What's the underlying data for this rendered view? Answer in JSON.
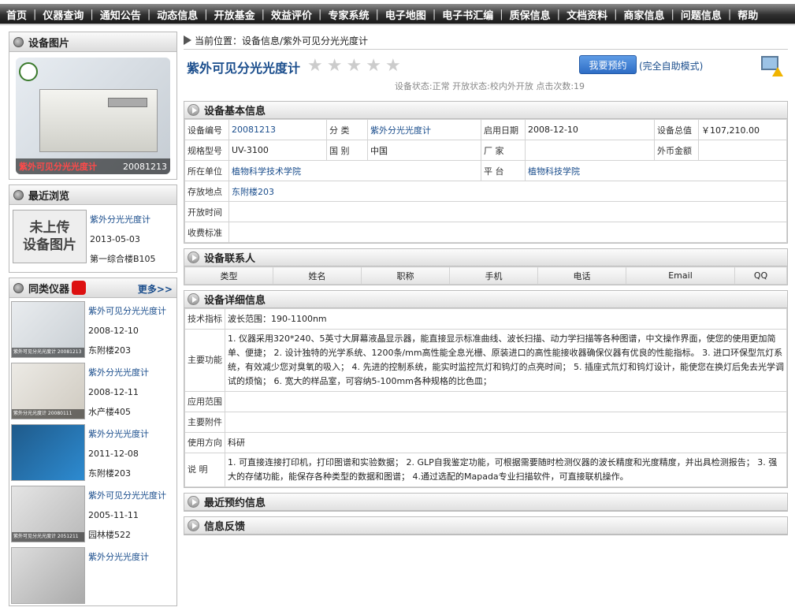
{
  "nav": [
    "首页",
    "仪器查询",
    "通知公告",
    "动态信息",
    "开放基金",
    "效益评价",
    "专家系统",
    "电子地图",
    "电子书汇编",
    "质保信息",
    "文档资料",
    "商家信息",
    "问题信息",
    "帮助"
  ],
  "sidebar": {
    "photo_title": "设备图片",
    "photo_caption_name": "紫外可见分光光度计",
    "photo_caption_id": "20081213",
    "recent_title": "最近浏览",
    "recent_nopic_1": "未上传",
    "recent_nopic_2": "设备图片",
    "recent": {
      "name": "紫外分光光度计",
      "date": "2013-05-03",
      "place": "第一综合楼B105"
    },
    "similar_title": "同类仪器",
    "more_label": "更多>>",
    "similar": [
      {
        "name": "紫外可见分光光度计",
        "date": "2008-12-10",
        "place": "东附楼203",
        "cap": "紫外可见分光光度计 20081213"
      },
      {
        "name": "紫外分光光度计",
        "date": "2008-12-11",
        "place": "水产楼405",
        "cap": "紫外分光光度计 20080111"
      },
      {
        "name": "紫外分光光度计",
        "date": "2011-12-08",
        "place": "东附楼203",
        "cap": ""
      },
      {
        "name": "紫外可见分光光度计",
        "date": "2005-11-11",
        "place": "园林楼522",
        "cap": "紫外可见分光光度计 2051211"
      },
      {
        "name": "紫外分光光度计",
        "date": "",
        "place": "",
        "cap": ""
      }
    ]
  },
  "crumb": "当前位置：设备信息/紫外可见分光光度计",
  "title": "紫外可见分光光度计",
  "reserve_label": "我要预约",
  "mode_label": "(完全自助模式)",
  "status": "设备状态:正常   开放状态:校内外开放   点击次数:19",
  "basic": {
    "heading": "设备基本信息",
    "l_code": "设备编号",
    "code": "20081213",
    "l_cat": "分    类",
    "cat": "紫外分光光度计",
    "l_date": "启用日期",
    "date": "2008-12-10",
    "l_total": "设备总值",
    "total": "￥107,210.00",
    "l_model": "规格型号",
    "model": "UV-3100",
    "l_country": "国    别",
    "country": "中国",
    "l_maker": "厂    家",
    "maker": "",
    "l_foreign": "外币金额",
    "foreign": "",
    "l_unit": "所在单位",
    "unit": "植物科学技术学院",
    "l_platform": "平    台",
    "platform": "植物科技学院",
    "l_loc": "存放地点",
    "loc": "东附楼203",
    "l_open": "开放时间",
    "open": "",
    "l_fee": "收费标准",
    "fee": ""
  },
  "contacts": {
    "heading": "设备联系人",
    "cols": [
      "类型",
      "姓名",
      "职称",
      "手机",
      "电话",
      "Email",
      "QQ"
    ]
  },
  "detail": {
    "heading": "设备详细信息",
    "l_spec": "技术指标",
    "spec": "波长范围：190-1100nm",
    "l_func": "主要功能",
    "func": "1. 仪器采用320*240、5英寸大屏幕液晶显示器，能直接显示标准曲线、波长扫描、动力学扫描等各种图谱，中文操作界面，使您的使用更加简单、便捷； 2. 设计独特的光学系统、1200条/mm高性能全息光栅、原装进口的高性能接收器确保仪器有优良的性能指标。 3. 进口环保型氘灯系统，有效减少您对臭氧的吸入； 4. 先进的控制系统，能实时监控氘灯和钨灯的点亮时间； 5. 插座式氘灯和钨灯设计，能使您在换灯后免去光学调试的烦恼； 6. 宽大的样品室，可容纳5-100mm各种规格的比色皿；",
    "l_scope": "应用范围",
    "scope": "",
    "l_acc": "主要附件",
    "acc": "",
    "l_dir": "使用方向",
    "dir": "科研",
    "l_note": "说    明",
    "note": "1. 可直接连接打印机，打印图谱和实验数据； 2. GLP自我鉴定功能，可根据需要随时检测仪器的波长精度和光度精度，并出具检测报告； 3. 强大的存储功能，能保存各种类型的数据和图谱； 4.通过选配的Mapada专业扫描软件，可直接联机操作。"
  },
  "recent_reserve_heading": "最近预约信息",
  "feedback_heading": "信息反馈"
}
